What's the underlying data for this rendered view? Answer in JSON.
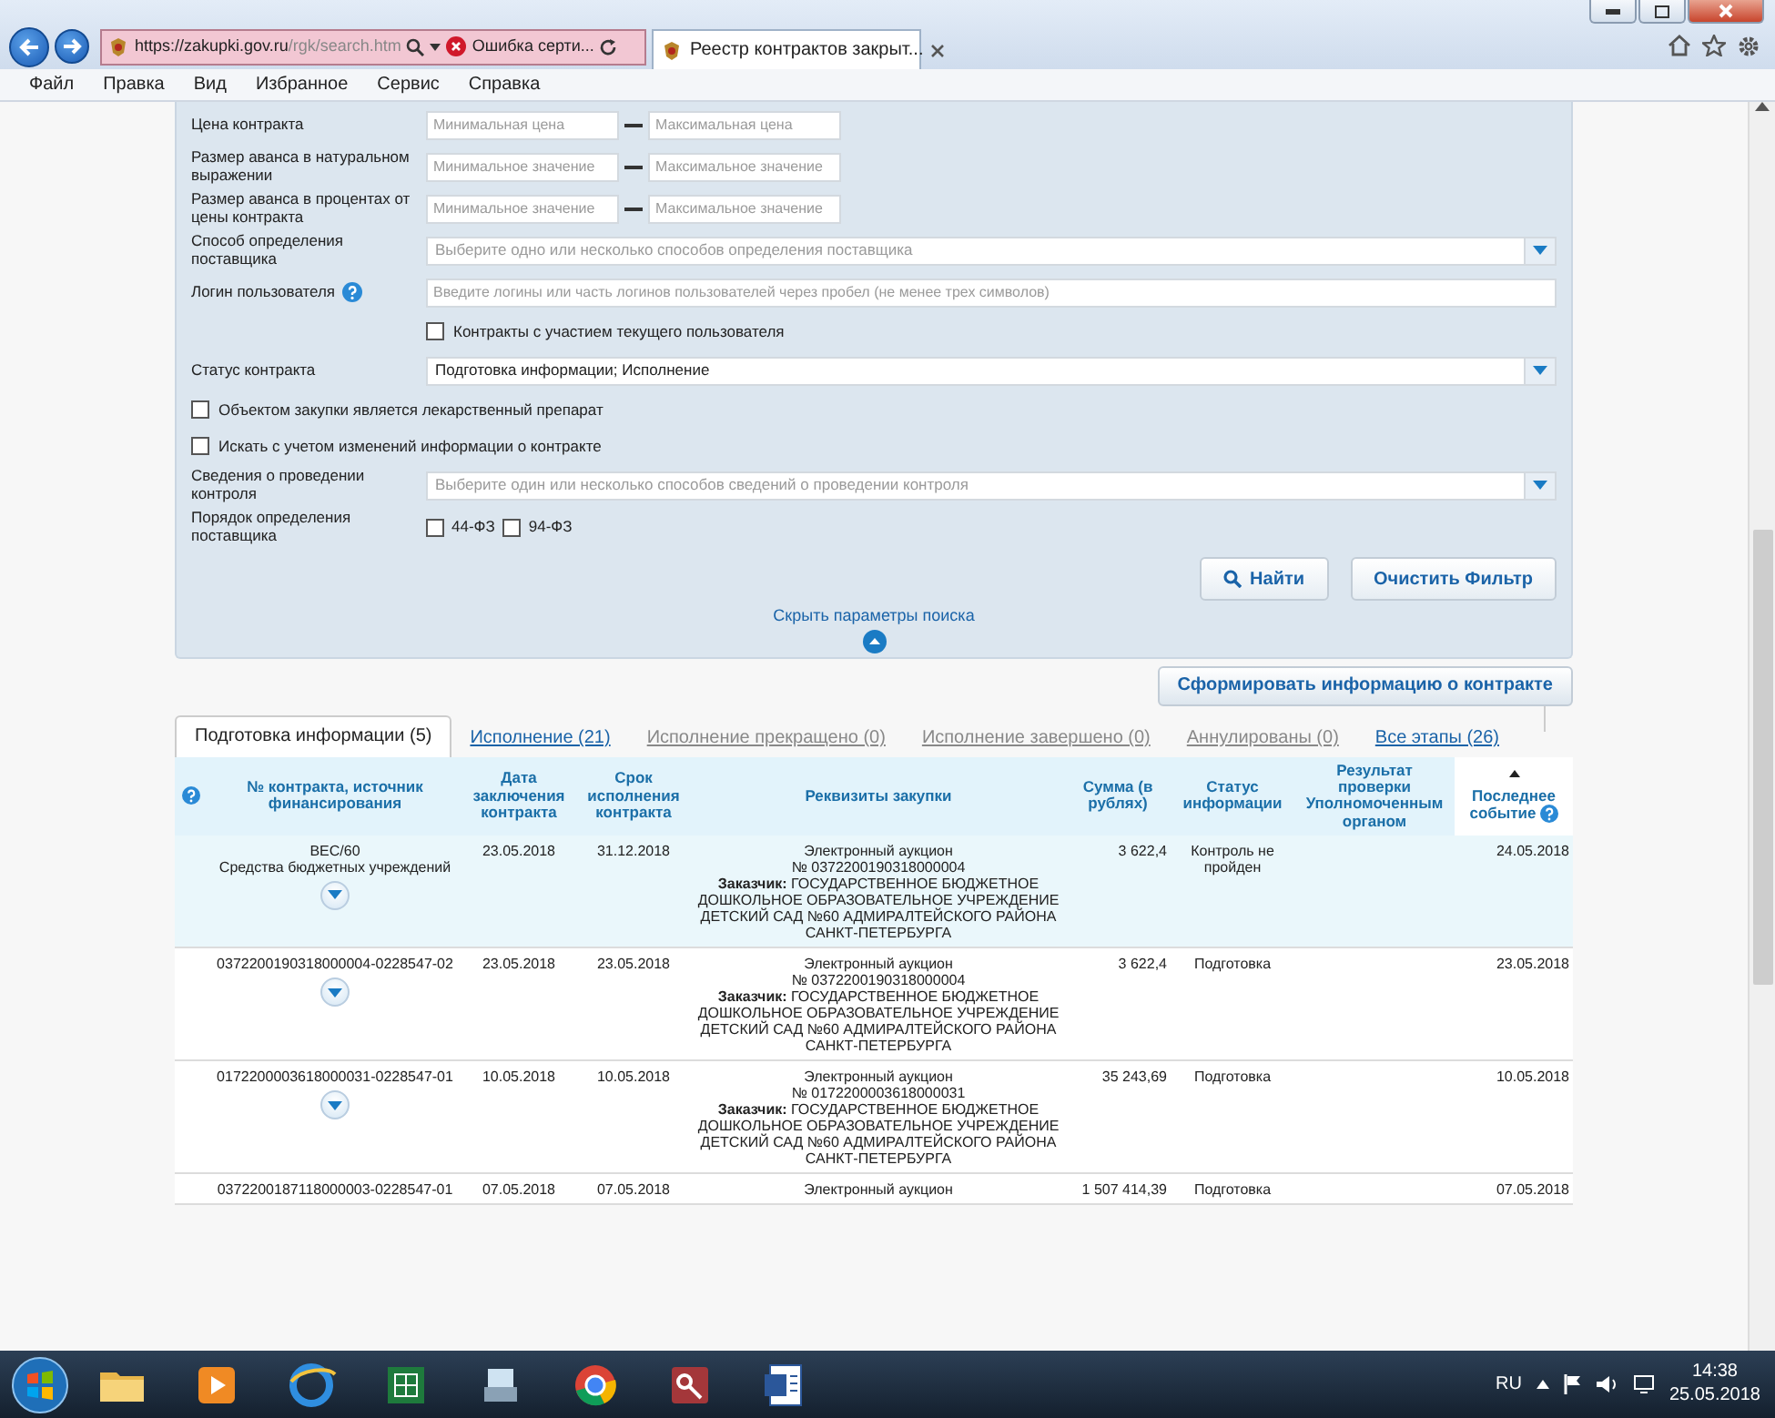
{
  "browser": {
    "address_host": "https://zakupki.gov.ru",
    "address_path": "/rgk/search.htm",
    "cert_error": "Ошибка серти...",
    "tabs": [
      {
        "label": "Реестр контрактов закрыт...",
        "selected": true
      }
    ]
  },
  "menu": [
    "Файл",
    "Правка",
    "Вид",
    "Избранное",
    "Сервис",
    "Справка"
  ],
  "filters": [
    {
      "kind": "range",
      "label": "Цена контракта",
      "min_placeholder": "Минимальная цена",
      "max_placeholder": "Максимальная цена"
    },
    {
      "kind": "range",
      "label": "Размер аванса в натуральном выражении",
      "min_placeholder": "Минимальное значение",
      "max_placeholder": "Максимальное значение"
    },
    {
      "kind": "range",
      "label": "Размер аванса в процентах от цены контракта",
      "min_placeholder": "Минимальное значение",
      "max_placeholder": "Максимальное значение"
    },
    {
      "kind": "select",
      "label": "Способ определения поставщика",
      "placeholder": "Выберите одно или несколько способов определения поставщика"
    },
    {
      "kind": "text",
      "label": "Логин пользователя",
      "help": true,
      "placeholder": "Введите логины или часть логинов пользователей через пробел (не менее трех символов)"
    },
    {
      "kind": "checkbox-aligned",
      "label": "Контракты с участием текущего пользователя",
      "checked": false
    },
    {
      "kind": "select",
      "label": "Статус контракта",
      "value": "Подготовка информации; Исполнение"
    },
    {
      "kind": "checkbox",
      "label": "Объектом закупки является лекарственный препарат",
      "checked": false
    },
    {
      "kind": "checkbox",
      "label": "Искать с учетом изменений информации о контракте",
      "checked": false
    },
    {
      "kind": "select",
      "label": "Сведения о проведении контроля",
      "placeholder": "Выберите один или несколько способов сведений о проведении контроля"
    },
    {
      "kind": "checkgroup",
      "label": "Порядок определения поставщика",
      "options": [
        {
          "label": "44-ФЗ",
          "checked": false
        },
        {
          "label": "94-ФЗ",
          "checked": false
        }
      ]
    }
  ],
  "buttons": {
    "search": "Найти",
    "clear": "Очистить Фильтр",
    "hide_link": "Скрыть параметры поиска",
    "generate": "Сформировать информацию о контракте"
  },
  "result_tabs": [
    {
      "label": "Подготовка информации (5)",
      "selected": true,
      "disabled": false
    },
    {
      "label": "Исполнение (21)",
      "selected": false,
      "disabled": false
    },
    {
      "label": "Исполнение прекращено (0)",
      "selected": false,
      "disabled": true
    },
    {
      "label": "Исполнение завершено (0)",
      "selected": false,
      "disabled": true
    },
    {
      "label": "Аннулированы (0)",
      "selected": false,
      "disabled": true
    },
    {
      "label": "Все этапы (26)",
      "selected": false,
      "disabled": false
    }
  ],
  "table": {
    "columns": [
      {
        "label": "№ контракта, источник финансирования",
        "sorted": false,
        "help": false
      },
      {
        "label": "Дата заключения контракта",
        "sorted": false,
        "help": false
      },
      {
        "label": "Срок исполнения контракта",
        "sorted": false,
        "help": false
      },
      {
        "label": "Реквизиты закупки",
        "sorted": false,
        "help": false
      },
      {
        "label": "Сумма (в рублях)",
        "sorted": false,
        "help": false
      },
      {
        "label": "Статус информации",
        "sorted": false,
        "help": false
      },
      {
        "label": "Результат проверки Уполномоченным органом",
        "sorted": false,
        "help": false
      },
      {
        "label": "Последнее событие",
        "sorted": true,
        "help": true
      }
    ],
    "rows": [
      {
        "highlighted": true,
        "expand": true,
        "number": "ВЕС/60",
        "source": "Средства бюджетных учреждений",
        "date_signed": "23.05.2018",
        "date_due": "31.12.2018",
        "method": "Электронный аукцион",
        "notice": "№ 0372200190318000004",
        "customer": "**Заказчик:** ГОСУДАРСТВЕННОЕ БЮДЖЕТНОЕ ДОШКОЛЬНОЕ ОБРАЗОВАТЕЛЬНОЕ УЧРЕЖДЕНИЕ ДЕТСКИЙ САД №60 АДМИРАЛТЕЙСКОГО РАЙОНА САНКТ-ПЕТЕРБУРГА",
        "sum": "3 622,4",
        "status": "Контроль не пройден",
        "last_event": "24.05.2018"
      },
      {
        "highlighted": false,
        "expand": true,
        "number": "0372200190318000004-0228547-02",
        "date_signed": "23.05.2018",
        "date_due": "23.05.2018",
        "method": "Электронный аукцион",
        "notice": "№ 0372200190318000004",
        "customer": "**Заказчик:** ГОСУДАРСТВЕННОЕ БЮДЖЕТНОЕ ДОШКОЛЬНОЕ ОБРАЗОВАТЕЛЬНОЕ УЧРЕЖДЕНИЕ ДЕТСКИЙ САД №60 АДМИРАЛТЕЙСКОГО РАЙОНА САНКТ-ПЕТЕРБУРГА",
        "sum": "3 622,4",
        "status": "Подготовка",
        "last_event": "23.05.2018"
      },
      {
        "highlighted": false,
        "expand": true,
        "number": "0172200003618000031-0228547-01",
        "date_signed": "10.05.2018",
        "date_due": "10.05.2018",
        "method": "Электронный аукцион",
        "notice": "№ 0172200003618000031",
        "customer": "**Заказчик:** ГОСУДАРСТВЕННОЕ БЮДЖЕТНОЕ ДОШКОЛЬНОЕ ОБРАЗОВАТЕЛЬНОЕ УЧРЕЖДЕНИЕ ДЕТСКИЙ САД №60 АДМИРАЛТЕЙСКОГО РАЙОНА САНКТ-ПЕТЕРБУРГА",
        "sum": "35 243,69",
        "status": "Подготовка",
        "last_event": "10.05.2018"
      },
      {
        "highlighted": false,
        "expand": false,
        "number": "0372200187118000003-0228547-01",
        "date_signed": "07.05.2018",
        "date_due": "07.05.2018",
        "method": "Электронный аукцион",
        "sum": "1 507 414,39",
        "status": "Подготовка",
        "last_event": "07.05.2018"
      }
    ]
  },
  "tray": {
    "language": "RU",
    "time": "14:38",
    "date": "25.05.2018"
  }
}
